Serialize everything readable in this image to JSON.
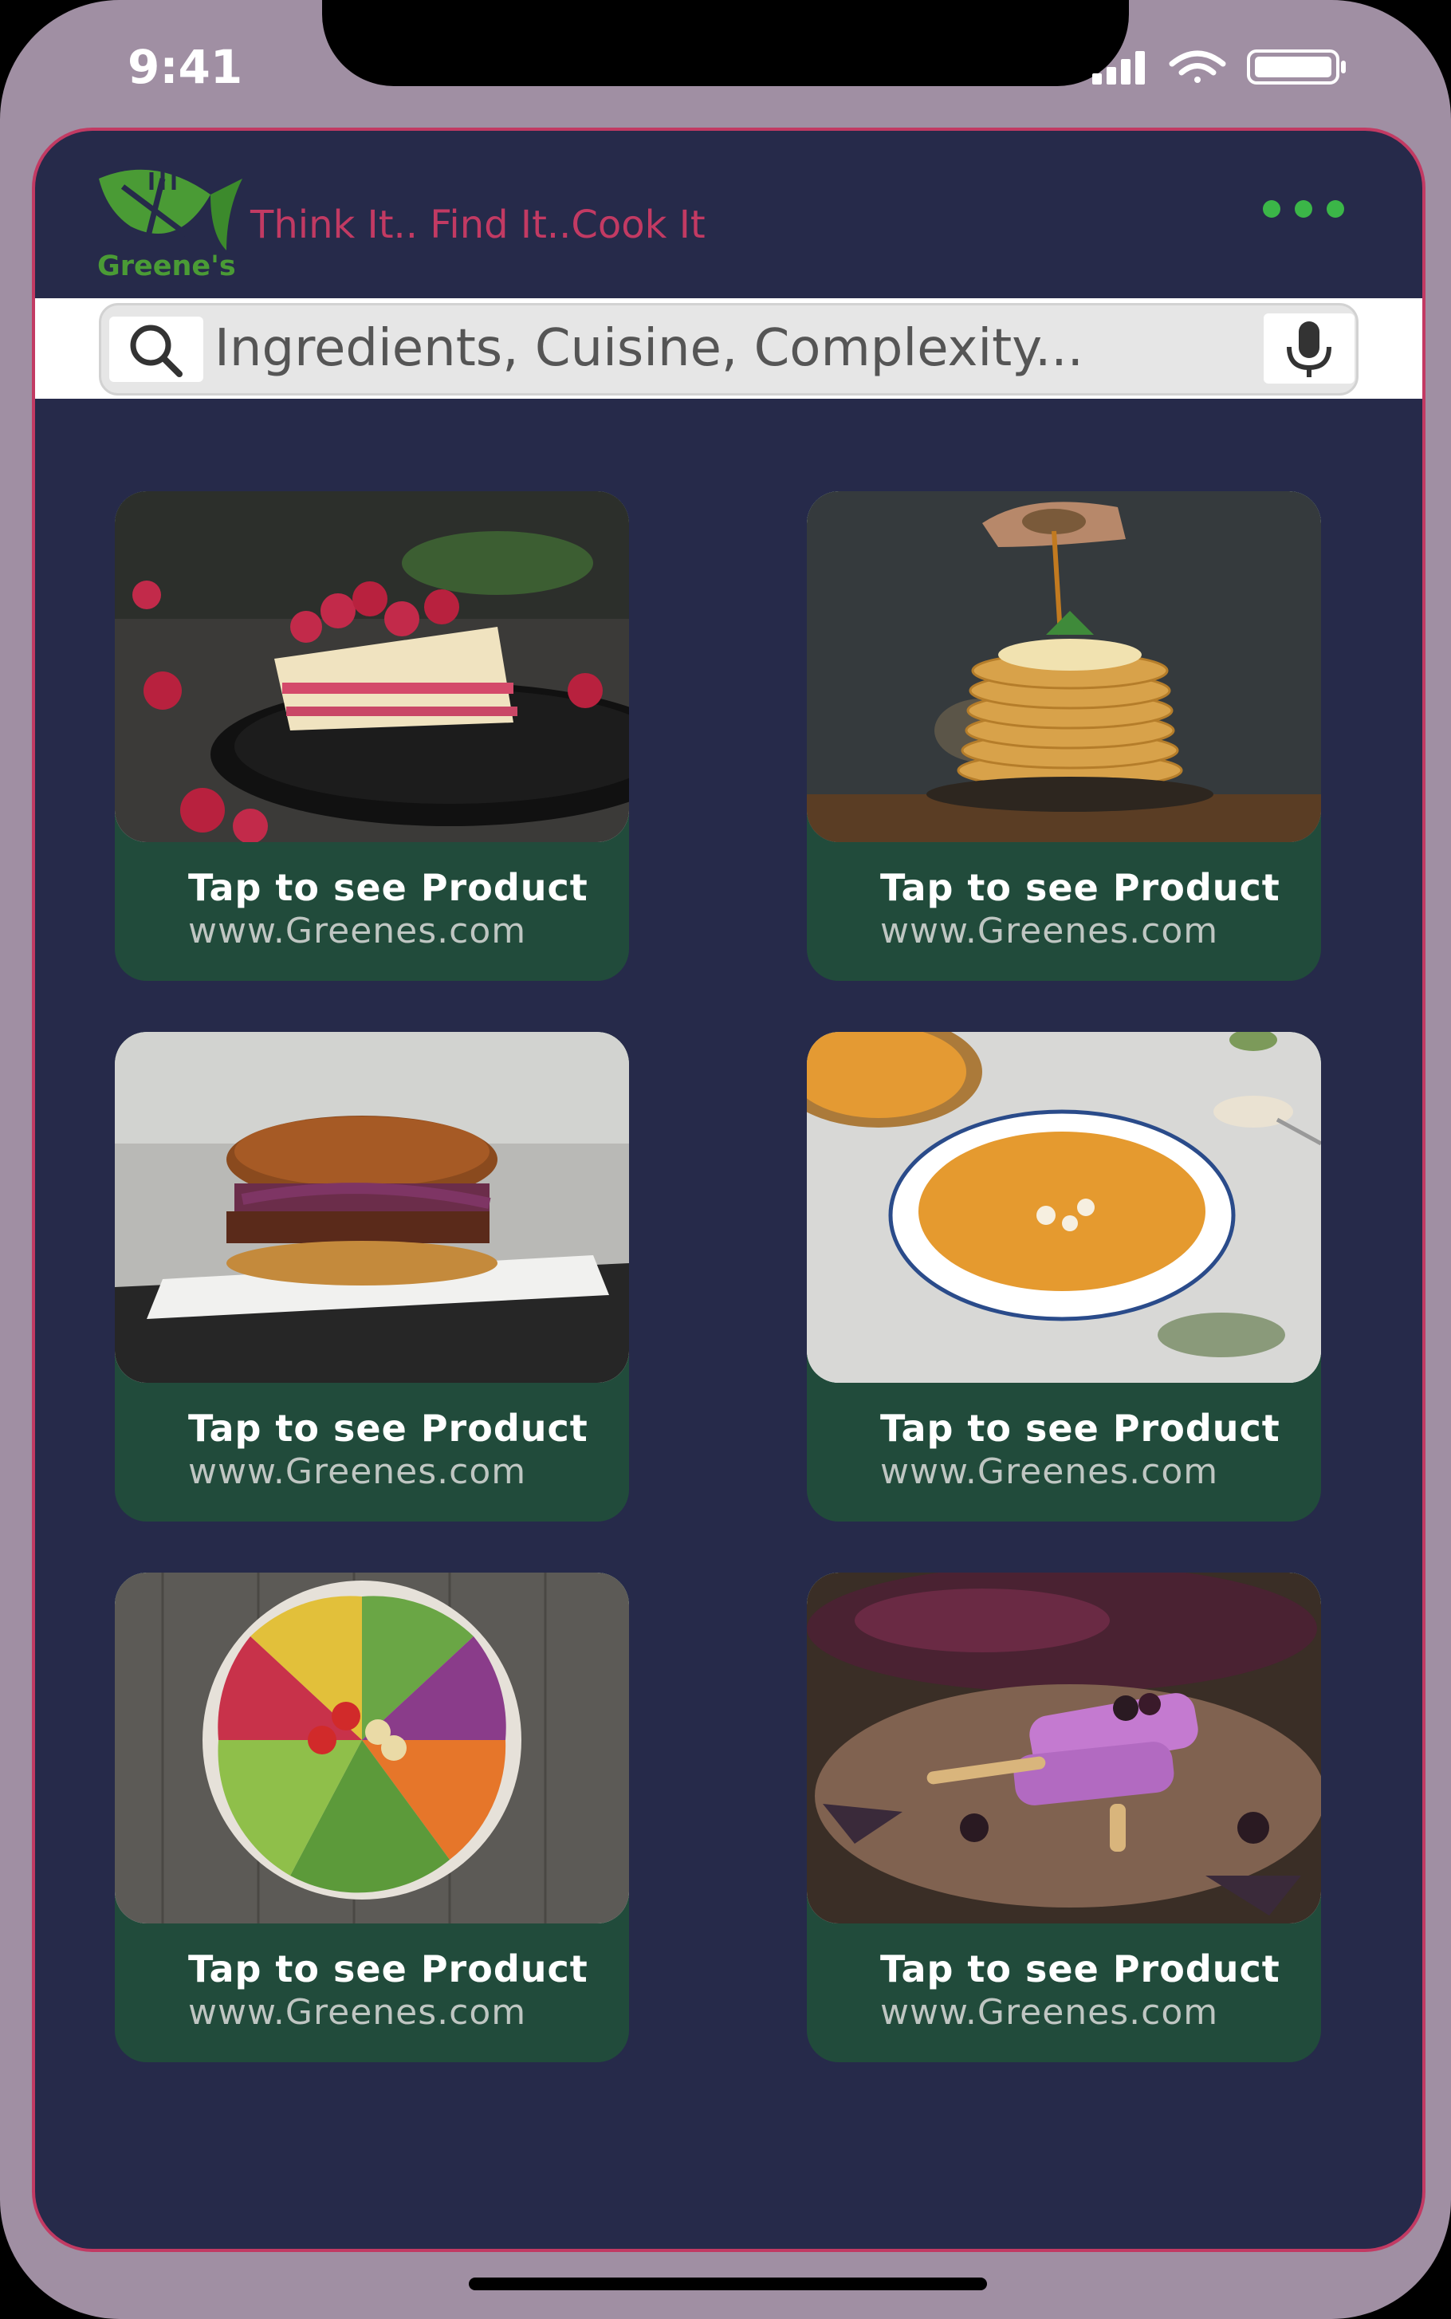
{
  "status_bar": {
    "time": "9:41"
  },
  "header": {
    "logo_text": "Greene's",
    "tagline": "Think It.. Find It..Cook It"
  },
  "search": {
    "placeholder": "Ingredients, Cuisine, Complexity..."
  },
  "cards": [
    {
      "title": "Tap to see Product",
      "url": "www.Greenes.com",
      "image": "raspberry-cake-photo"
    },
    {
      "title": "Tap to see Product",
      "url": "www.Greenes.com",
      "image": "pancake-stack-photo"
    },
    {
      "title": "Tap to see Product",
      "url": "www.Greenes.com",
      "image": "burger-photo"
    },
    {
      "title": "Tap to see Product",
      "url": "www.Greenes.com",
      "image": "pumpkin-soup-photo"
    },
    {
      "title": "Tap to see Product",
      "url": "www.Greenes.com",
      "image": "salad-bowl-photo"
    },
    {
      "title": "Tap to see Product",
      "url": "www.Greenes.com",
      "image": "berry-popsicle-photo"
    }
  ],
  "colors": {
    "background": "#262a4a",
    "accent": "#c23a63",
    "card": "#214b3b",
    "brand_green": "#4a9b35",
    "phone_frame": "#a08fa3"
  }
}
